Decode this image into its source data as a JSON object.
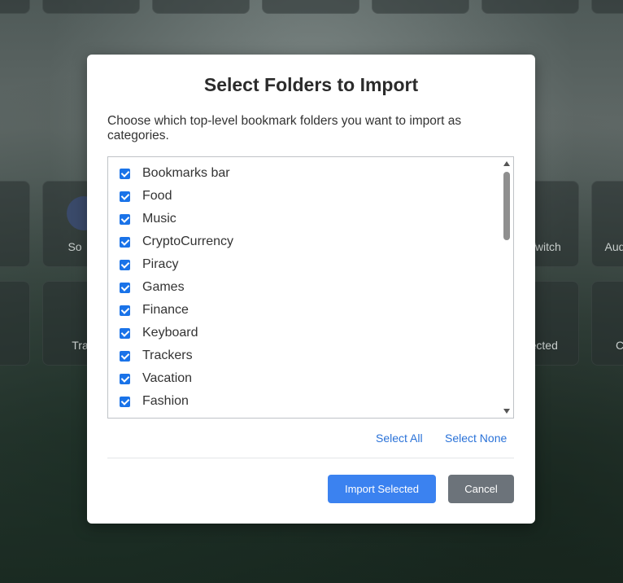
{
  "background_tiles": {
    "row1_labels": [
      "So",
      "Trav"
    ],
    "row1_right_labels": [
      "Twitch",
      "Aud"
    ],
    "row2_right_labels": [
      "Connected",
      "C"
    ]
  },
  "modal": {
    "title": "Select Folders to Import",
    "description": "Choose which top-level bookmark folders you want to import as categories.",
    "folders": [
      {
        "label": "Bookmarks bar",
        "checked": true
      },
      {
        "label": "Food",
        "checked": true
      },
      {
        "label": "Music",
        "checked": true
      },
      {
        "label": "CryptoCurrency",
        "checked": true
      },
      {
        "label": "Piracy",
        "checked": true
      },
      {
        "label": "Games",
        "checked": true
      },
      {
        "label": "Finance",
        "checked": true
      },
      {
        "label": "Keyboard",
        "checked": true
      },
      {
        "label": "Trackers",
        "checked": true
      },
      {
        "label": "Vacation",
        "checked": true
      },
      {
        "label": "Fashion",
        "checked": true
      }
    ],
    "select_all_label": "Select All",
    "select_none_label": "Select None",
    "import_button_label": "Import Selected",
    "cancel_button_label": "Cancel"
  },
  "colors": {
    "primary": "#3b82f0",
    "secondary": "#6c737a",
    "link": "#2a72d8",
    "checkbox": "#1a73e8"
  }
}
